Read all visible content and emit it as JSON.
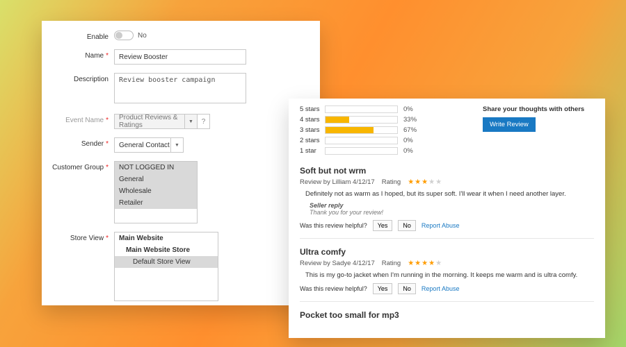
{
  "admin": {
    "enable": {
      "label": "Enable",
      "value_text": "No"
    },
    "name": {
      "label": "Name",
      "value": "Review Booster"
    },
    "description": {
      "label": "Description",
      "value": "Review booster campaign"
    },
    "event": {
      "label": "Event Name",
      "value": "Product Reviews & Ratings"
    },
    "sender": {
      "label": "Sender",
      "value": "General Contact"
    },
    "customer_group": {
      "label": "Customer Group",
      "options": [
        "NOT LOGGED IN",
        "General",
        "Wholesale",
        "Retailer"
      ]
    },
    "store_view": {
      "label": "Store View",
      "tree": {
        "root": "Main Website",
        "store": "Main Website Store",
        "view": "Default Store View"
      }
    }
  },
  "reviews": {
    "share_title": "Share your thoughts with others",
    "write_label": "Write Review",
    "bars": [
      {
        "label": "5 stars",
        "pct": "0%",
        "fill": 0
      },
      {
        "label": "4 stars",
        "pct": "33%",
        "fill": 33
      },
      {
        "label": "3 stars",
        "pct": "67%",
        "fill": 67
      },
      {
        "label": "2 stars",
        "pct": "0%",
        "fill": 0
      },
      {
        "label": "1 star",
        "pct": "0%",
        "fill": 0
      }
    ],
    "rating_word": "Rating",
    "helpful_prompt": "Was this review helpful?",
    "yes": "Yes",
    "no": "No",
    "report": "Report Abuse",
    "seller_reply_h": "Seller reply",
    "items": [
      {
        "title": "Soft but not wrm",
        "byline": "Review by Lilliam 4/12/17",
        "stars": 3,
        "body": "Definitely not as warm as I hoped, but its super soft. I'll wear it when I need another layer.",
        "seller_reply": "Thank you for your review!"
      },
      {
        "title": "Ultra comfy",
        "byline": "Review by Sadye 4/12/17",
        "stars": 4,
        "body": "This is my go-to jacket when I'm running in the morning. It keeps me warm and is ultra comfy."
      },
      {
        "title": "Pocket too small for mp3"
      }
    ]
  }
}
